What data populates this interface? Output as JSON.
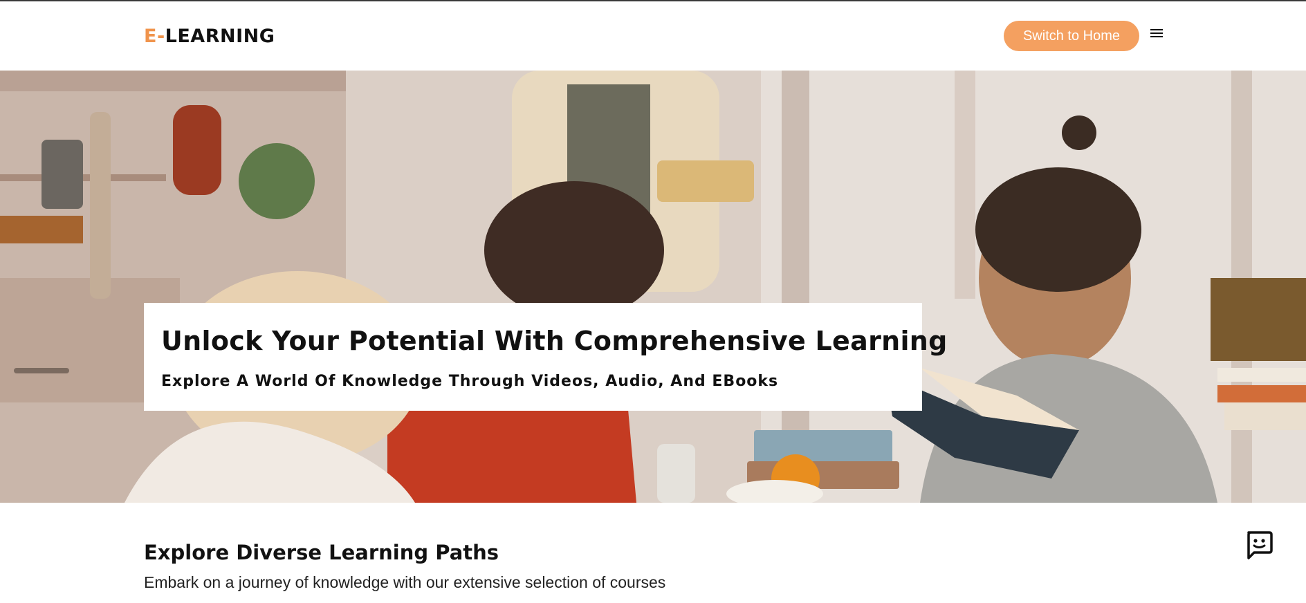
{
  "header": {
    "logo_accent": "E-",
    "logo_rest": "LEARNING",
    "switch_label": "Switch to Home",
    "menu_icon": "hamburger-menu-icon"
  },
  "hero": {
    "title": "Unlock Your Potential With Comprehensive Learning",
    "subtitle": "Explore A World Of Knowledge Through Videos, Audio, And EBooks"
  },
  "section": {
    "title": "Explore Diverse Learning Paths",
    "subtitle": "Embark on a journey of knowledge with our extensive selection of courses"
  },
  "chat": {
    "icon": "chat-bubble-icon"
  },
  "colors": {
    "accent": "#f0944c",
    "button": "#f4a060",
    "text": "#111111"
  }
}
